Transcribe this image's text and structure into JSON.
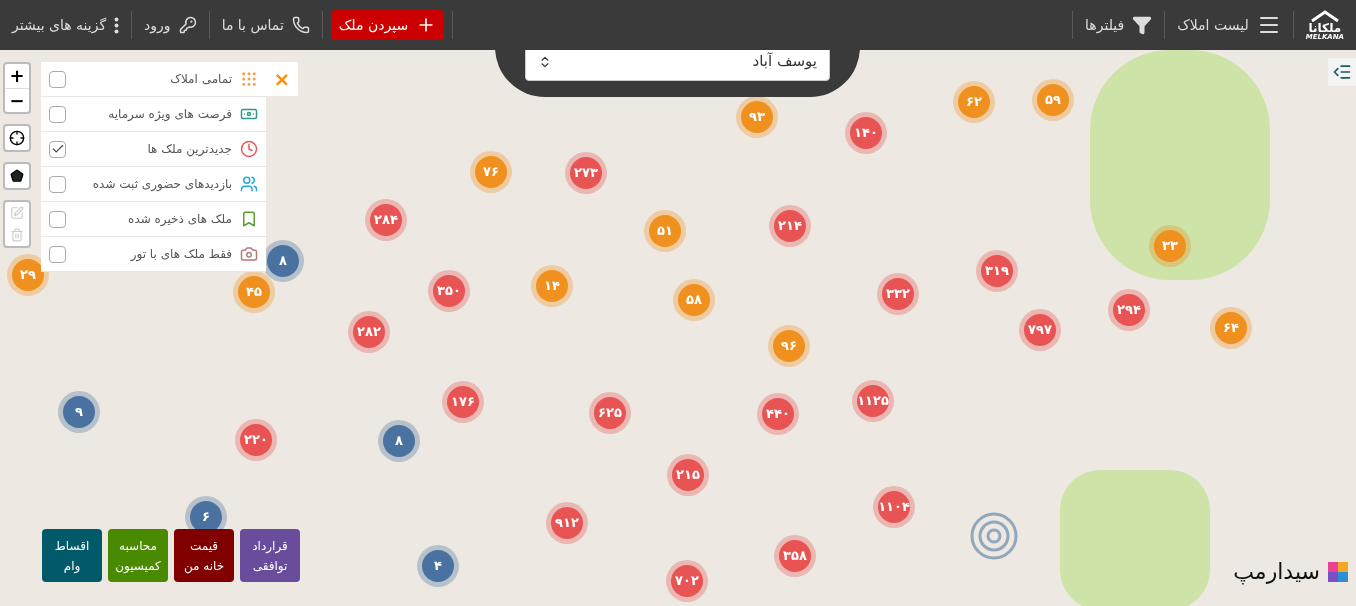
{
  "header": {
    "logo": {
      "name": "ملکانا",
      "latin": "MELKANA"
    },
    "nav": [
      {
        "kind": "menu",
        "label": "لیست املاک"
      },
      {
        "kind": "filter",
        "label": "فیلترها"
      }
    ],
    "actions": [
      {
        "kind": "primary",
        "label": "سپردن ملک"
      },
      {
        "kind": "phone",
        "label": "تماس با ما"
      },
      {
        "kind": "login",
        "label": "ورود"
      },
      {
        "kind": "more",
        "label": "گزینه های بیشتر"
      }
    ]
  },
  "search": {
    "value": "یوسف آباد"
  },
  "map_controls": {
    "zoom_in": "+",
    "zoom_out": "−"
  },
  "filters": {
    "close": "×",
    "items": [
      {
        "label": "تمامی املاک",
        "checked": false
      },
      {
        "label": "فرصت های ویژه سرمایه",
        "checked": false
      },
      {
        "label": "جدیدترین ملک ها",
        "checked": true
      },
      {
        "label": "بازدیدهای حضوری ثبت شده",
        "checked": false
      },
      {
        "label": "ملک های ذخیره شده",
        "checked": false
      },
      {
        "label": "فقط ملک های با تور",
        "checked": false
      }
    ]
  },
  "clusters": [
    {
      "count": "۵۹",
      "color": "#f0901e"
    },
    {
      "count": "۶۲",
      "color": "#f0901e"
    },
    {
      "count": "۱۴۰",
      "color": "#e85454"
    },
    {
      "count": "۹۳",
      "color": "#f0901e"
    },
    {
      "count": "۲۷۳",
      "color": "#e85454"
    },
    {
      "count": "۷۶",
      "color": "#f0901e"
    },
    {
      "count": "۲۱۴",
      "color": "#e85454"
    },
    {
      "count": "۵۱",
      "color": "#f0901e"
    },
    {
      "count": "۲۸۴",
      "color": "#e85454"
    },
    {
      "count": "۳۳",
      "color": "#f0901e"
    },
    {
      "count": "۳۱۹",
      "color": "#e85454"
    },
    {
      "count": "۳۳۲",
      "color": "#e85454"
    },
    {
      "count": "۵۸",
      "color": "#f0901e"
    },
    {
      "count": "۱۴",
      "color": "#f0901e"
    },
    {
      "count": "۳۵۰",
      "color": "#e85454"
    },
    {
      "count": "۸",
      "color": "#4a72a0"
    },
    {
      "count": "۴۵",
      "color": "#f0901e"
    },
    {
      "count": "۲۹",
      "color": "#f0901e"
    },
    {
      "count": "۶۴",
      "color": "#f0901e"
    },
    {
      "count": "۲۹۴",
      "color": "#e85454"
    },
    {
      "count": "۷۹۷",
      "color": "#e85454"
    },
    {
      "count": "۹۶",
      "color": "#f0901e"
    },
    {
      "count": "۲۸۲",
      "color": "#e85454"
    },
    {
      "count": "۱۱۲۵",
      "color": "#e85454"
    },
    {
      "count": "۴۴۰",
      "color": "#e85454"
    },
    {
      "count": "۶۲۵",
      "color": "#e85454"
    },
    {
      "count": "۱۷۶",
      "color": "#e85454"
    },
    {
      "count": "۹",
      "color": "#4a72a0"
    },
    {
      "count": "۸",
      "color": "#4a72a0"
    },
    {
      "count": "۲۲۰",
      "color": "#e85454"
    },
    {
      "count": "۱۱۰۴",
      "color": "#e85454"
    },
    {
      "count": "۲۱۵",
      "color": "#e85454"
    },
    {
      "count": "۹۱۲",
      "color": "#e85454"
    },
    {
      "count": "۶",
      "color": "#4a72a0"
    },
    {
      "count": "۳۵۸",
      "color": "#e85454"
    },
    {
      "count": "۷۰۲",
      "color": "#e85454"
    },
    {
      "count": "۴",
      "color": "#4a72a0"
    }
  ],
  "quick_links": [
    {
      "label": "قرارداد\nتوافقی",
      "color": "#6a4c9c"
    },
    {
      "label": "قیمت\nخانه من",
      "color": "#800000"
    },
    {
      "label": "محاسبه\nکمیسیون",
      "color": "#4a8a00"
    },
    {
      "label": "اقساط\nوام",
      "color": "#005a6a"
    }
  ],
  "attribution": {
    "label": "سیدارمپ"
  }
}
